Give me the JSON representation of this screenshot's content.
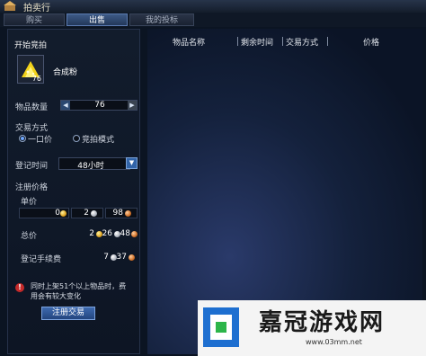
{
  "window": {
    "title": "拍卖行"
  },
  "tabs": [
    {
      "label": "购买",
      "active": false
    },
    {
      "label": "出售",
      "active": true
    },
    {
      "label": "我的投标",
      "active": false
    }
  ],
  "sell_panel": {
    "section_title": "开始竞拍",
    "item": {
      "name": "合成粉",
      "count": "76",
      "icon": "gold-powder-icon"
    },
    "quantity": {
      "label": "物品数量",
      "value": "76"
    },
    "trade_mode": {
      "label": "交易方式",
      "options": [
        {
          "label": "一口价",
          "selected": true
        },
        {
          "label": "竞拍模式",
          "selected": false
        }
      ]
    },
    "register_time": {
      "label": "登记时间",
      "value": "48小时"
    },
    "register_price": {
      "label": "注册价格",
      "unit_price": {
        "label": "单价",
        "gold": "0",
        "silver": "2",
        "copper": "98"
      },
      "total_price": {
        "label": "总价",
        "gold": "2",
        "silver": "26",
        "copper": "48"
      },
      "fee": {
        "label": "登记手续费",
        "silver": "7",
        "copper": "37"
      }
    },
    "warning": "同时上架51个以上物品时，费用会有较大变化",
    "register_button": "注册交易"
  },
  "listing_table": {
    "columns": [
      "物品名称",
      "剩余时间",
      "交易方式",
      "价格"
    ]
  },
  "watermark": {
    "brand": "嘉冠游戏网",
    "url": "www.03mm.net"
  },
  "colors": {
    "accent_blue": "#3264a8",
    "panel_bg": "#121c2c",
    "warning_red": "#c62a2a",
    "gold": "#e0a420",
    "silver": "#b0b6c0",
    "copper": "#d07028"
  }
}
